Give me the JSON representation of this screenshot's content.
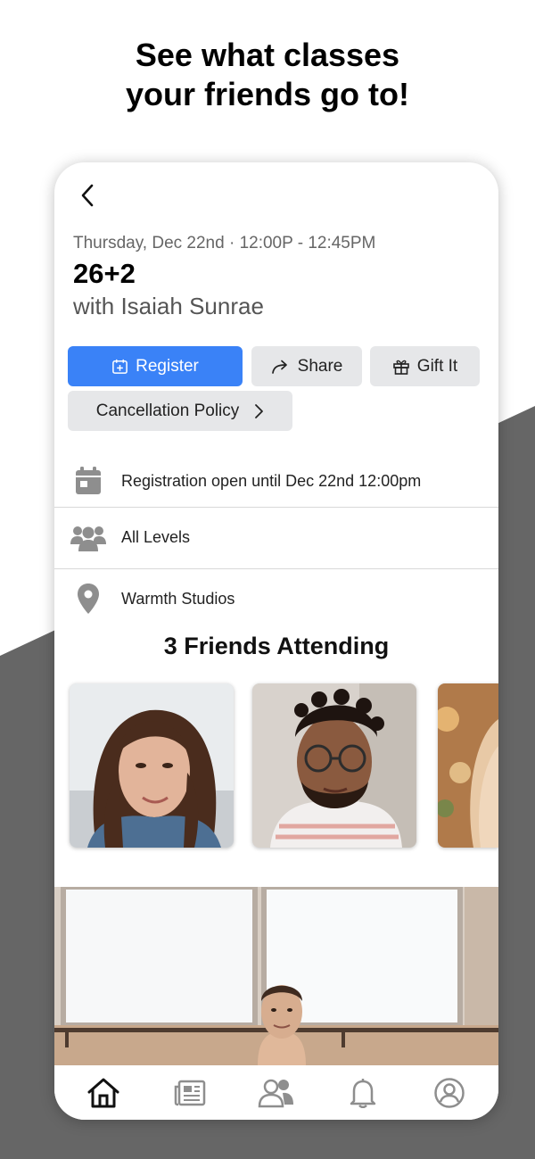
{
  "promo": {
    "headline_line1": "See what classes",
    "headline_line2": "your friends go to!"
  },
  "colors": {
    "accent": "#3a82f7",
    "background_shape": "#666666",
    "button_gray": "#e6e7e9",
    "icon_gray": "#8e8e8e"
  },
  "class": {
    "datetime": "Thursday, Dec 22nd · 12:00P - 12:45PM",
    "title": "26+2",
    "instructor": "with Isaiah Sunrae"
  },
  "actions": {
    "register_label": "Register",
    "share_label": "Share",
    "gift_label": "Gift It",
    "policy_label": "Cancellation Policy"
  },
  "details": [
    {
      "icon": "calendar-icon",
      "text": "Registration open until Dec 22nd 12:00pm"
    },
    {
      "icon": "group-icon",
      "text": "All Levels"
    },
    {
      "icon": "location-pin-icon",
      "text": "Warmth Studios"
    }
  ],
  "friends": {
    "title": "3 Friends Attending"
  },
  "bottom_nav": [
    {
      "icon": "home-icon",
      "active": true
    },
    {
      "icon": "news-icon",
      "active": false
    },
    {
      "icon": "friends-icon",
      "active": false
    },
    {
      "icon": "bell-icon",
      "active": false
    },
    {
      "icon": "profile-icon",
      "active": false
    }
  ]
}
